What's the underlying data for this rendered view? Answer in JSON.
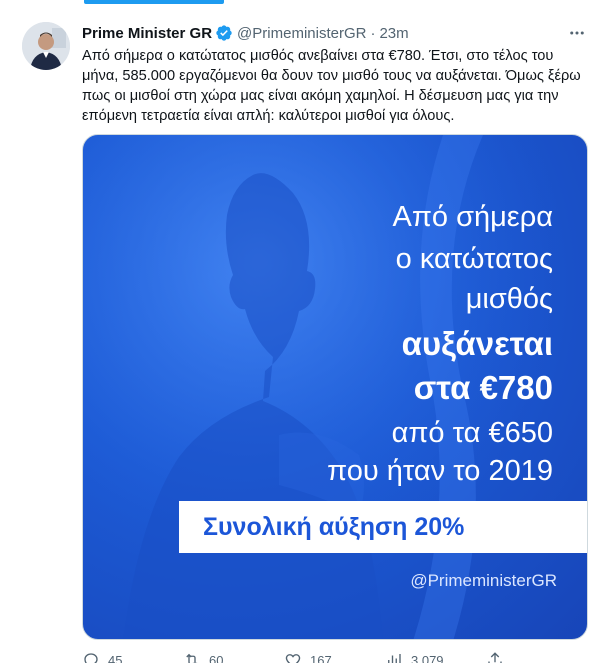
{
  "author": {
    "name": "Prime Minister GR",
    "handle": "@PrimeministerGR",
    "separator": "·",
    "time": "23m"
  },
  "tweet": {
    "text": "Από σήμερα ο κατώτατος μισθός ανεβαίνει στα €780. Έτσι, στο τέλος του μήνα, 585.000 εργαζόμενοι θα δουν τον μισθό τους να αυξάνεται. Όμως ξέρω πως οι μισθοί στη χώρα μας είναι ακόμη χαμηλοί. Η δέσμευση μας για την επόμενη τετραετία είναι απλή: καλύτεροι μισθοί για όλους."
  },
  "media": {
    "line1": "Από σήμερα",
    "line2": "ο κατώτατος",
    "line3": "μισθός",
    "line4": "αυξάνεται",
    "line5": "στα €780",
    "line6": "από τα €650",
    "line7": "που ήταν το 2019",
    "banner": "Συνολική αύξηση 20%",
    "watermark": "@PrimeministerGR"
  },
  "actions": {
    "replies": "45",
    "retweets": "60",
    "likes": "167",
    "views": "3.079"
  },
  "icons": {
    "verified": "verified-badge-icon",
    "more": "more-options-icon",
    "reply": "reply-icon",
    "retweet": "retweet-icon",
    "like": "heart-icon",
    "views": "views-chart-icon",
    "share": "share-icon"
  },
  "colors": {
    "accent": "#1d9bf0",
    "media_blue": "#1d5bd6",
    "banner_text": "#1c56d8"
  }
}
